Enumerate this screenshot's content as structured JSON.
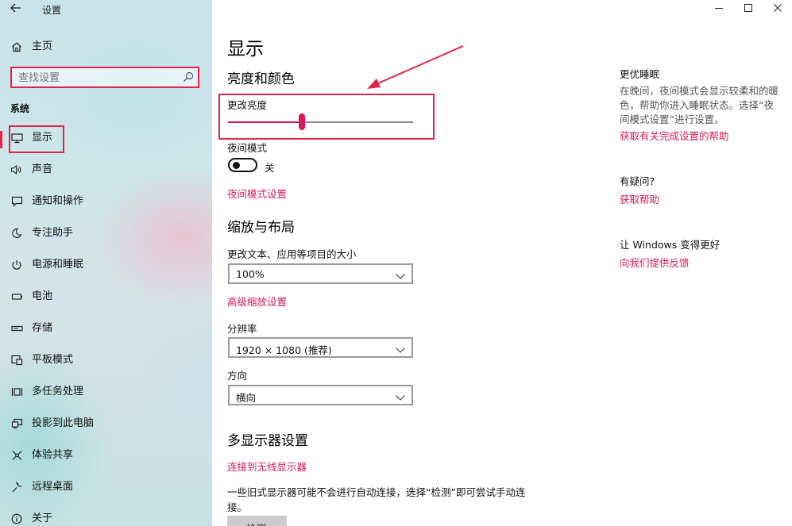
{
  "window": {
    "title": "设置",
    "back_icon": "back-arrow-icon",
    "controls": {
      "minimize": "—",
      "maximize": "☐",
      "close": "✕"
    }
  },
  "sidebar": {
    "home_label": "主页",
    "search": {
      "placeholder": "查找设置",
      "value": ""
    },
    "section_label": "系统",
    "items": [
      {
        "label": "显示",
        "icon": "monitor-icon",
        "active": true
      },
      {
        "label": "声音",
        "icon": "speaker-icon"
      },
      {
        "label": "通知和操作",
        "icon": "notification-icon"
      },
      {
        "label": "专注助手",
        "icon": "moon-icon"
      },
      {
        "label": "电源和睡眠",
        "icon": "power-icon"
      },
      {
        "label": "电池",
        "icon": "battery-icon"
      },
      {
        "label": "存储",
        "icon": "storage-icon"
      },
      {
        "label": "平板模式",
        "icon": "tablet-icon"
      },
      {
        "label": "多任务处理",
        "icon": "multitask-icon"
      },
      {
        "label": "投影到此电脑",
        "icon": "project-icon"
      },
      {
        "label": "体验共享",
        "icon": "share-icon"
      },
      {
        "label": "远程桌面",
        "icon": "remote-icon"
      },
      {
        "label": "关于",
        "icon": "info-icon"
      }
    ]
  },
  "main": {
    "title": "显示",
    "brightness_section": "亮度和颜色",
    "brightness_label": "更改亮度",
    "brightness_value": 0.4,
    "night_mode_label": "夜间模式",
    "night_mode_state": "关",
    "night_mode_on": false,
    "night_mode_link": "夜间模式设置",
    "scale_section": "缩放与布局",
    "scale_label": "更改文本、应用等项目的大小",
    "scale_value": "100%",
    "advanced_scale_link": "高级缩放设置",
    "resolution_label": "分辨率",
    "resolution_value": "1920 × 1080 (推荐)",
    "orientation_label": "方向",
    "orientation_value": "横向",
    "multi_display_section": "多显示器设置",
    "wireless_link": "连接到无线显示器",
    "multi_display_text": "一些旧式显示器可能不会进行自动连接，选择“检测”即可尝试手动连接。",
    "detect_button": "检测"
  },
  "right": {
    "sleep_heading": "更优睡眠",
    "sleep_text": "在晚间，夜间模式会显示较柔和的暖色，帮助你进入睡眠状态。选择“夜间模式设置”进行设置。",
    "sleep_link": "获取有关完成设置的帮助",
    "question_heading": "有疑问?",
    "help_link": "获取帮助",
    "windows_heading": "让 Windows 变得更好",
    "feedback_link": "向我们提供反馈"
  },
  "colors": {
    "accent": "#d31b57",
    "annotation": "#e0244a"
  }
}
